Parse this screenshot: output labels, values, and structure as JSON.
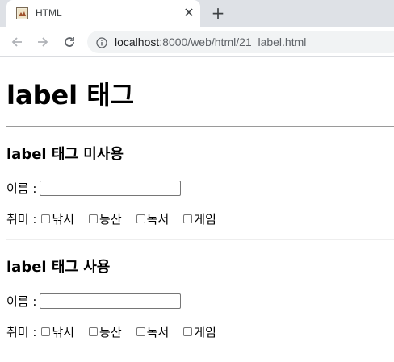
{
  "browser": {
    "tab_title": "HTML",
    "close_glyph": "✕",
    "new_tab_glyph": "+",
    "url_host": "localhost",
    "url_rest": ":8000/web/html/21_label.html",
    "icons": [
      "favicon-icon",
      "back-arrow-icon",
      "forward-arrow-icon",
      "reload-icon",
      "info-icon",
      "close-icon",
      "plus-icon"
    ]
  },
  "page": {
    "title": "label 태그",
    "section1": {
      "heading": "label 태그 미사용",
      "name_label": "이름 :",
      "name_value": "",
      "hobby_label": "취미 :",
      "hobbies": [
        "낚시",
        "등산",
        "독서",
        "게임"
      ]
    },
    "section2": {
      "heading": "label 태그 사용",
      "name_label": "이름 :",
      "name_value": "",
      "hobby_label": "취미 :",
      "hobbies": [
        "낚시",
        "등산",
        "독서",
        "게임"
      ]
    }
  }
}
